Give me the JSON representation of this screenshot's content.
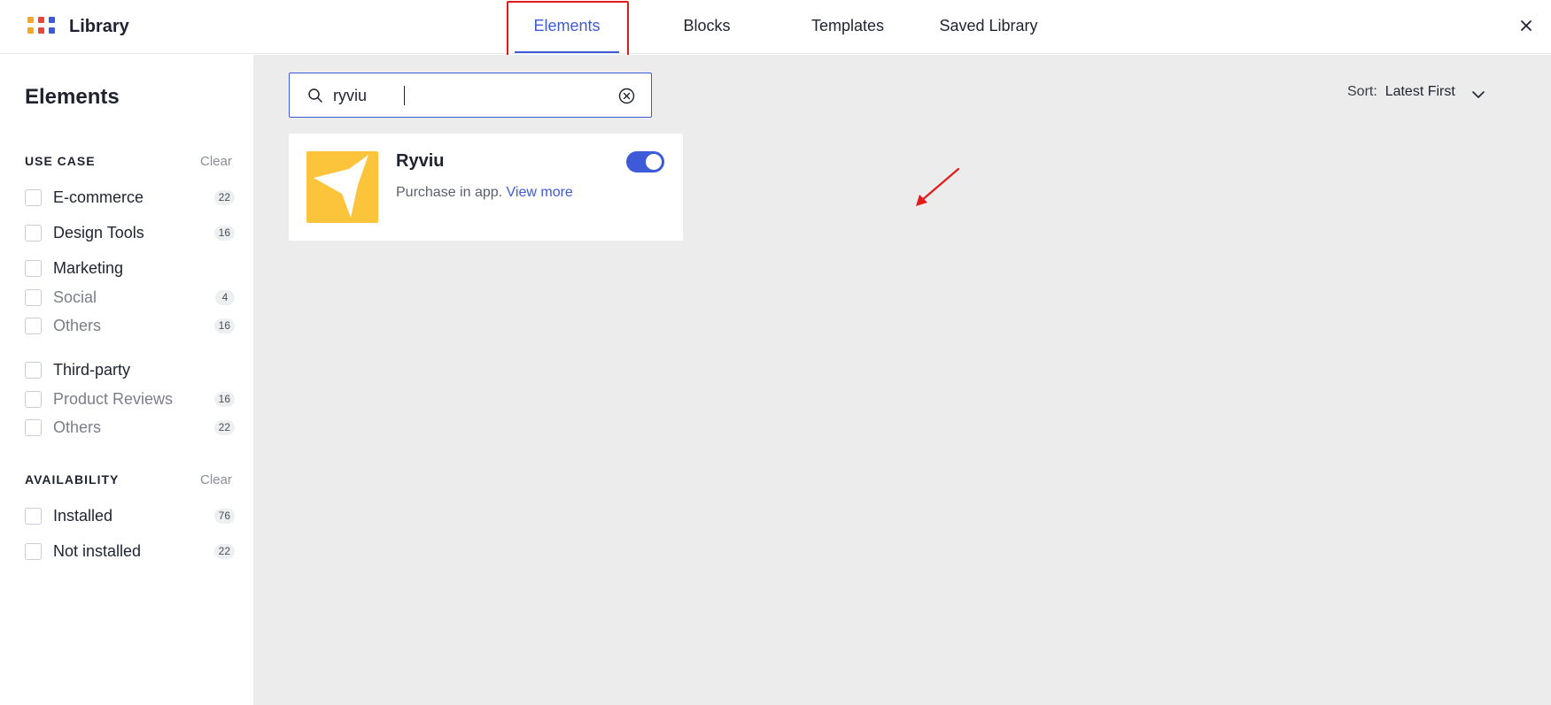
{
  "header": {
    "app_title": "Library",
    "tabs": [
      {
        "label": "Elements",
        "active": true
      },
      {
        "label": "Blocks",
        "active": false
      },
      {
        "label": "Templates",
        "active": false
      },
      {
        "label": "Saved Library",
        "active": false
      }
    ],
    "logo_colors": [
      "#f5a623",
      "#e8453c",
      "#3d5bd9",
      "#f5a623",
      "#e8453c",
      "#3d5bd9"
    ],
    "close_icon": "close-icon"
  },
  "sidebar": {
    "title": "Elements",
    "use_case": {
      "label": "USE CASE",
      "clear": "Clear",
      "items": [
        {
          "label": "E-commerce",
          "count": "22",
          "sub": false
        },
        {
          "label": "Design Tools",
          "count": "16",
          "sub": false
        },
        {
          "label": "Marketing",
          "count": "",
          "sub": false
        },
        {
          "label": "Social",
          "count": "4",
          "sub": true
        },
        {
          "label": "Others",
          "count": "16",
          "sub": true
        },
        {
          "label": "Third-party",
          "count": "",
          "sub": false
        },
        {
          "label": "Product Reviews",
          "count": "16",
          "sub": true
        },
        {
          "label": "Others",
          "count": "22",
          "sub": true
        }
      ]
    },
    "availability": {
      "label": "AVAILABILITY",
      "clear": "Clear",
      "items": [
        {
          "label": "Installed",
          "count": "76"
        },
        {
          "label": "Not installed",
          "count": "22"
        }
      ]
    }
  },
  "main": {
    "search": {
      "value": "ryviu",
      "icon": "search-icon",
      "clear_icon": "clear-circle-icon"
    },
    "sort": {
      "label": "Sort:",
      "value": "Latest First",
      "icon": "chevron-down-icon"
    },
    "results": [
      {
        "title": "Ryviu",
        "description": "Purchase in app.",
        "link": "View more",
        "enabled": true,
        "thumb_color": "#fbc43a"
      }
    ]
  },
  "colors": {
    "accent": "#3d5bd9",
    "highlight": "#e31b1b",
    "canvas": "#ececec"
  }
}
